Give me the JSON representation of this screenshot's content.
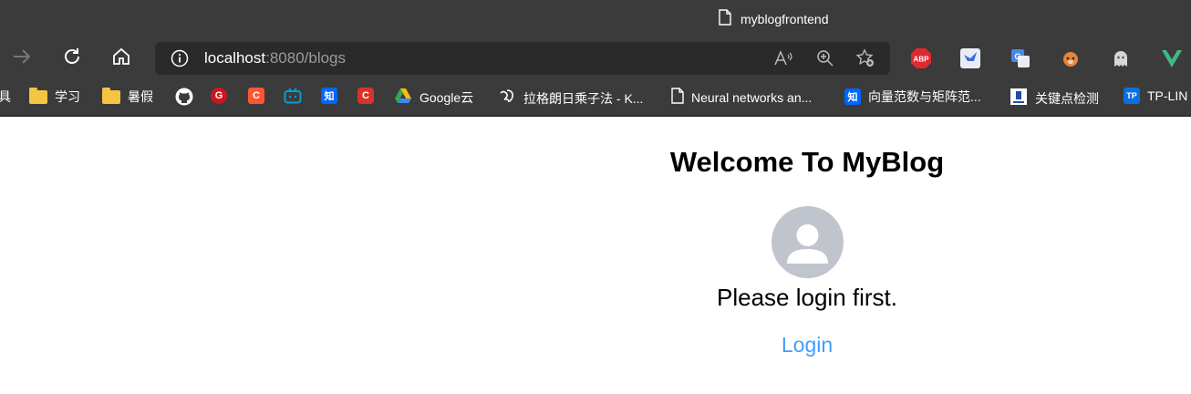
{
  "browser": {
    "tab_title": "myblogfrontend",
    "address": {
      "host": "localhost",
      "rest": ":8080/blogs"
    },
    "extensions": [
      "ABP",
      "bird-extension",
      "translate-extension",
      "fox-extension",
      "ghost-extension",
      "V"
    ]
  },
  "bookmarks": [
    {
      "label": "具",
      "icon": "folder-cut-icon"
    },
    {
      "label": "学习",
      "icon": "folder-icon"
    },
    {
      "label": "暑假",
      "icon": "folder-icon"
    },
    {
      "label": "",
      "icon": "github-icon"
    },
    {
      "label": "",
      "icon": "g-icon"
    },
    {
      "label": "",
      "icon": "csdn-icon"
    },
    {
      "label": "",
      "icon": "bilibili-icon"
    },
    {
      "label": "",
      "icon": "zhihu-icon"
    },
    {
      "label": "",
      "icon": "csdn-icon"
    },
    {
      "label": "Google云",
      "icon": "google-drive-icon"
    },
    {
      "label": "拉格朗日乘子法 - K...",
      "icon": "om-icon"
    },
    {
      "label": "Neural networks an...",
      "icon": "page-icon"
    },
    {
      "label": "向量范数与矩阵范...",
      "icon": "zhihu-icon"
    },
    {
      "label": "关键点检测",
      "icon": "doc-icon"
    },
    {
      "label": "TP-LIN",
      "icon": "tp-icon"
    }
  ],
  "icon_text": {
    "abp": "ABP",
    "v": "V",
    "zhi": "知",
    "c": "C",
    "g": "G",
    "tp": "TP"
  },
  "page": {
    "title": "Welcome To MyBlog",
    "message": "Please login first.",
    "login_link": "Login"
  },
  "colors": {
    "accent": "#409eff",
    "chrome": "#3b3b3b",
    "avatar_bg": "#c0c4cc"
  }
}
